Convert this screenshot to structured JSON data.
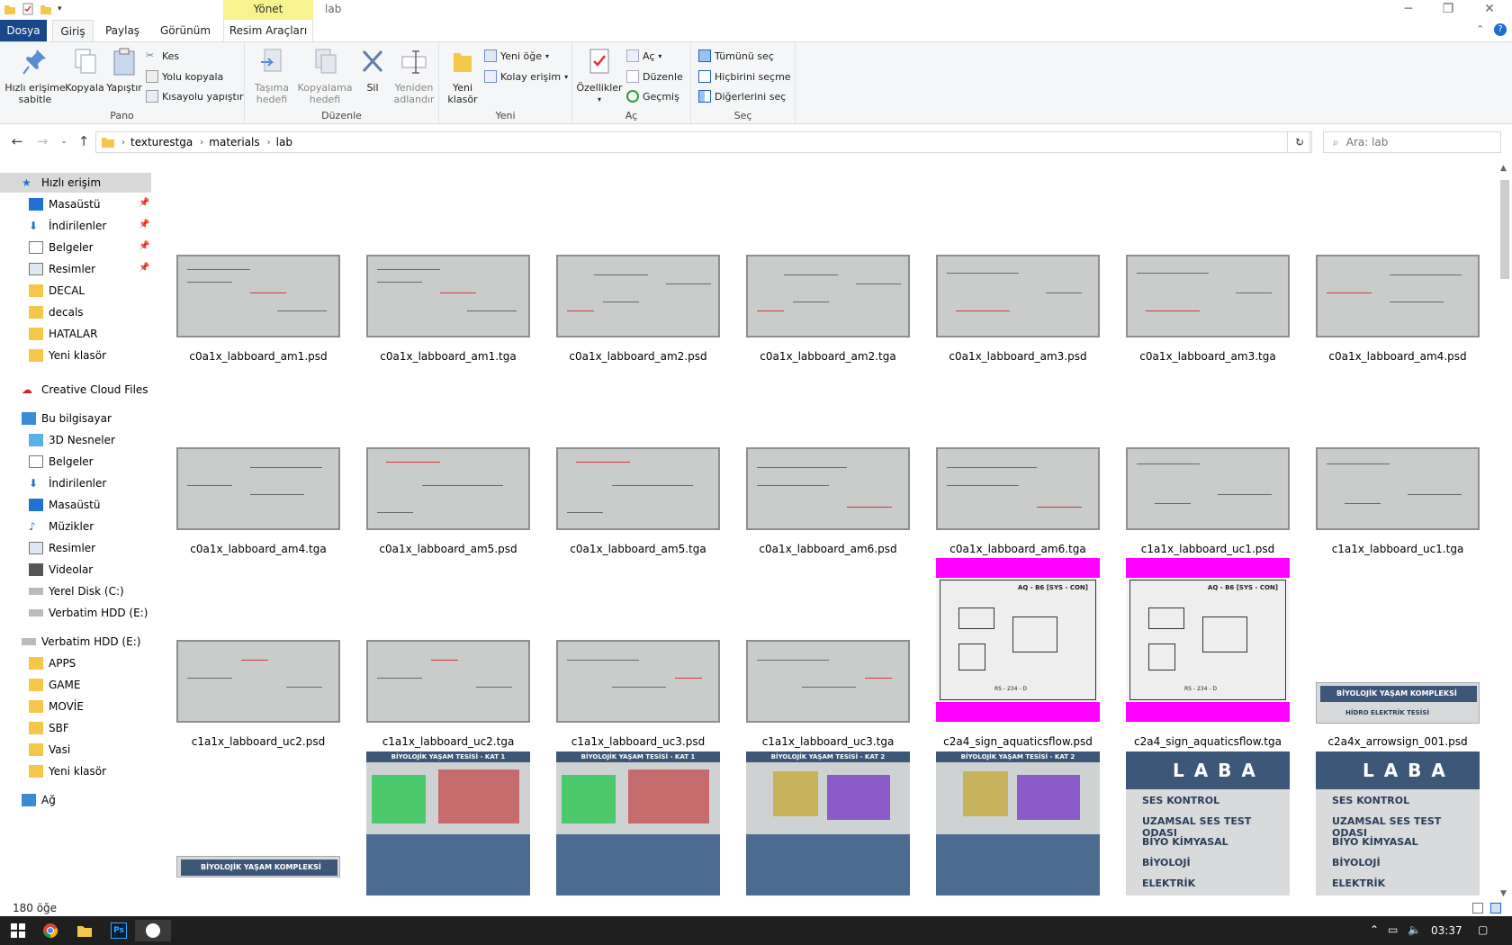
{
  "window": {
    "title": "lab",
    "manage_tab": "Yönet",
    "controls": [
      "─",
      "❐",
      "✕"
    ]
  },
  "tabs": {
    "dosya": "Dosya",
    "giris": "Giriş",
    "paylas": "Paylaş",
    "gorunum": "Görünüm",
    "resim_araclari": "Resim Araçları"
  },
  "ribbon": {
    "pano": {
      "label": "Pano",
      "pin": "Hızlı erişime sabitle",
      "copy": "Kopyala",
      "paste": "Yapıştır",
      "cut": "Kes",
      "copy_path": "Yolu kopyala",
      "paste_shortcut": "Kısayolu yapıştır"
    },
    "duzenle": {
      "label": "Düzenle",
      "move_to": "Taşıma hedefi",
      "copy_to": "Kopyalama hedefi",
      "delete": "Sil",
      "rename": "Yeniden adlandır"
    },
    "yeni": {
      "label": "Yeni",
      "new_folder": "Yeni klasör",
      "new_item": "Yeni öğe",
      "easy_access": "Kolay erişim"
    },
    "ac": {
      "label": "Aç",
      "properties": "Özellikler",
      "open": "Aç",
      "edit": "Düzenle",
      "history": "Geçmiş"
    },
    "sec": {
      "label": "Seç",
      "select_all": "Tümünü seç",
      "select_none": "Hiçbirini seçme",
      "invert": "Diğerlerini seç"
    }
  },
  "address": {
    "crumbs": [
      "texturestga",
      "materials",
      "lab"
    ],
    "search_placeholder": "Ara: lab"
  },
  "nav": {
    "quick_access": "Hızlı erişim",
    "quick_items": [
      "Masaüstü",
      "İndirilenler",
      "Belgeler",
      "Resimler",
      "DECAL",
      "decals",
      "HATALAR",
      "Yeni klasör"
    ],
    "creative_cloud": "Creative Cloud Files",
    "this_pc": "Bu bilgisayar",
    "pc_items": [
      "3D Nesneler",
      "Belgeler",
      "İndirilenler",
      "Masaüstü",
      "Müzikler",
      "Resimler",
      "Videolar",
      "Yerel Disk (C:)",
      "Verbatim HDD (E:)"
    ],
    "drive": "Verbatim HDD (E:)",
    "drive_items": [
      "APPS",
      "GAME",
      "MOVİE",
      "SBF",
      "Vasi",
      "Yeni klasör"
    ],
    "network": "Ağ"
  },
  "files": [
    "c0a1x_labboard_am1.psd",
    "c0a1x_labboard_am1.tga",
    "c0a1x_labboard_am2.psd",
    "c0a1x_labboard_am2.tga",
    "c0a1x_labboard_am3.psd",
    "c0a1x_labboard_am3.tga",
    "c0a1x_labboard_am4.psd",
    "c0a1x_labboard_am4.tga",
    "c0a1x_labboard_am5.psd",
    "c0a1x_labboard_am5.tga",
    "c0a1x_labboard_am6.psd",
    "c0a1x_labboard_am6.tga",
    "c1a1x_labboard_uc1.psd",
    "c1a1x_labboard_uc1.tga",
    "c1a1x_labboard_uc2.psd",
    "c1a1x_labboard_uc2.tga",
    "c1a1x_labboard_uc3.psd",
    "c1a1x_labboard_uc3.tga",
    "c2a4_sign_aquaticsflow.psd",
    "c2a4_sign_aquaticsflow.tga",
    "c2a4x_arrowsign_001.psd"
  ],
  "thumb_text": {
    "schematic_title": "AQ - B6 [SYS - CON]",
    "schematic_sub": "RS - 234 - D",
    "arrow_1": "BİYOLOJİK YAŞAM KOMPLEKSİ",
    "arrow_2": "HİDRO ELEKTRİK TESİSİ",
    "map_1": "BİYOLOJİK YAŞAM TESİSİ - KAT 1",
    "map_2": "BİYOLOJİK YAŞAM TESİSİ - KAT 2",
    "lab_title": "L A B  A",
    "lab_items": [
      "SES KONTROL",
      "UZAMSAL SES TEST ODASI",
      "BİYO KİMYASAL",
      "BİYOLOJİ",
      "ELEKTRİK"
    ],
    "bottom_arrow": "BİYOLOJİK YAŞAM KOMPLEKSİ"
  },
  "status": {
    "count": "180 öğe"
  },
  "taskbar": {
    "time": "03:37"
  }
}
